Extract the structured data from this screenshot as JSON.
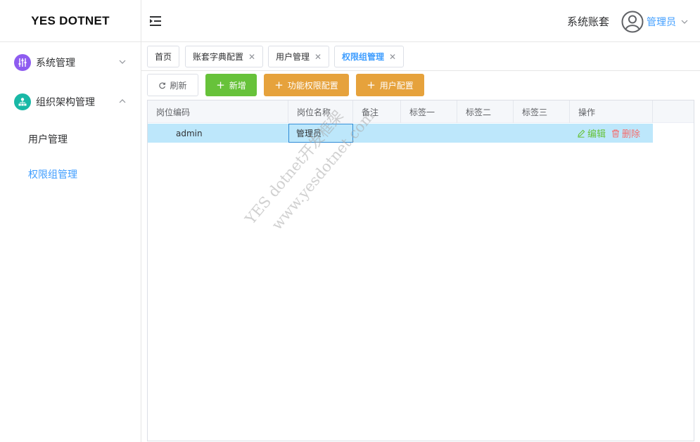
{
  "sidebar": {
    "logo": "YES DOTNET",
    "groups": [
      {
        "label": "系统管理",
        "icon": "sliders-icon",
        "icon_color": "#8e5cf0",
        "expanded": false
      },
      {
        "label": "组织架构管理",
        "icon": "org-tree-icon",
        "icon_color": "#19b8a6",
        "expanded": true
      }
    ],
    "items": [
      {
        "label": "用户管理",
        "active": false
      },
      {
        "label": "权限组管理",
        "active": true
      }
    ]
  },
  "header": {
    "account": "系统账套",
    "user": "管理员"
  },
  "tabs": [
    {
      "label": "首页",
      "closable": false
    },
    {
      "label": "账套字典配置",
      "closable": true
    },
    {
      "label": "用户管理",
      "closable": true
    },
    {
      "label": "权限组管理",
      "closable": true,
      "active": true
    }
  ],
  "toolbar": {
    "refresh": "刷新",
    "add": "新增",
    "func_perm": "功能权限配置",
    "user_config": "用户配置"
  },
  "grid": {
    "columns": [
      "岗位编码",
      "岗位名称",
      "备注",
      "标签一",
      "标签二",
      "标签三",
      "操作"
    ],
    "rows": [
      {
        "code": "admin",
        "name": "管理员",
        "remark": "",
        "tag1": "",
        "tag2": "",
        "tag3": "",
        "edit": "编辑",
        "delete": "删除"
      }
    ]
  },
  "watermark": {
    "line1": "YES dotnet开发框架",
    "line2": "www.yesdotnet.com"
  },
  "colors": {
    "primary": "#409eff",
    "success": "#67c23a",
    "warning": "#e6a23c",
    "danger": "#f56c6c",
    "row_selected": "#bde7fb"
  }
}
